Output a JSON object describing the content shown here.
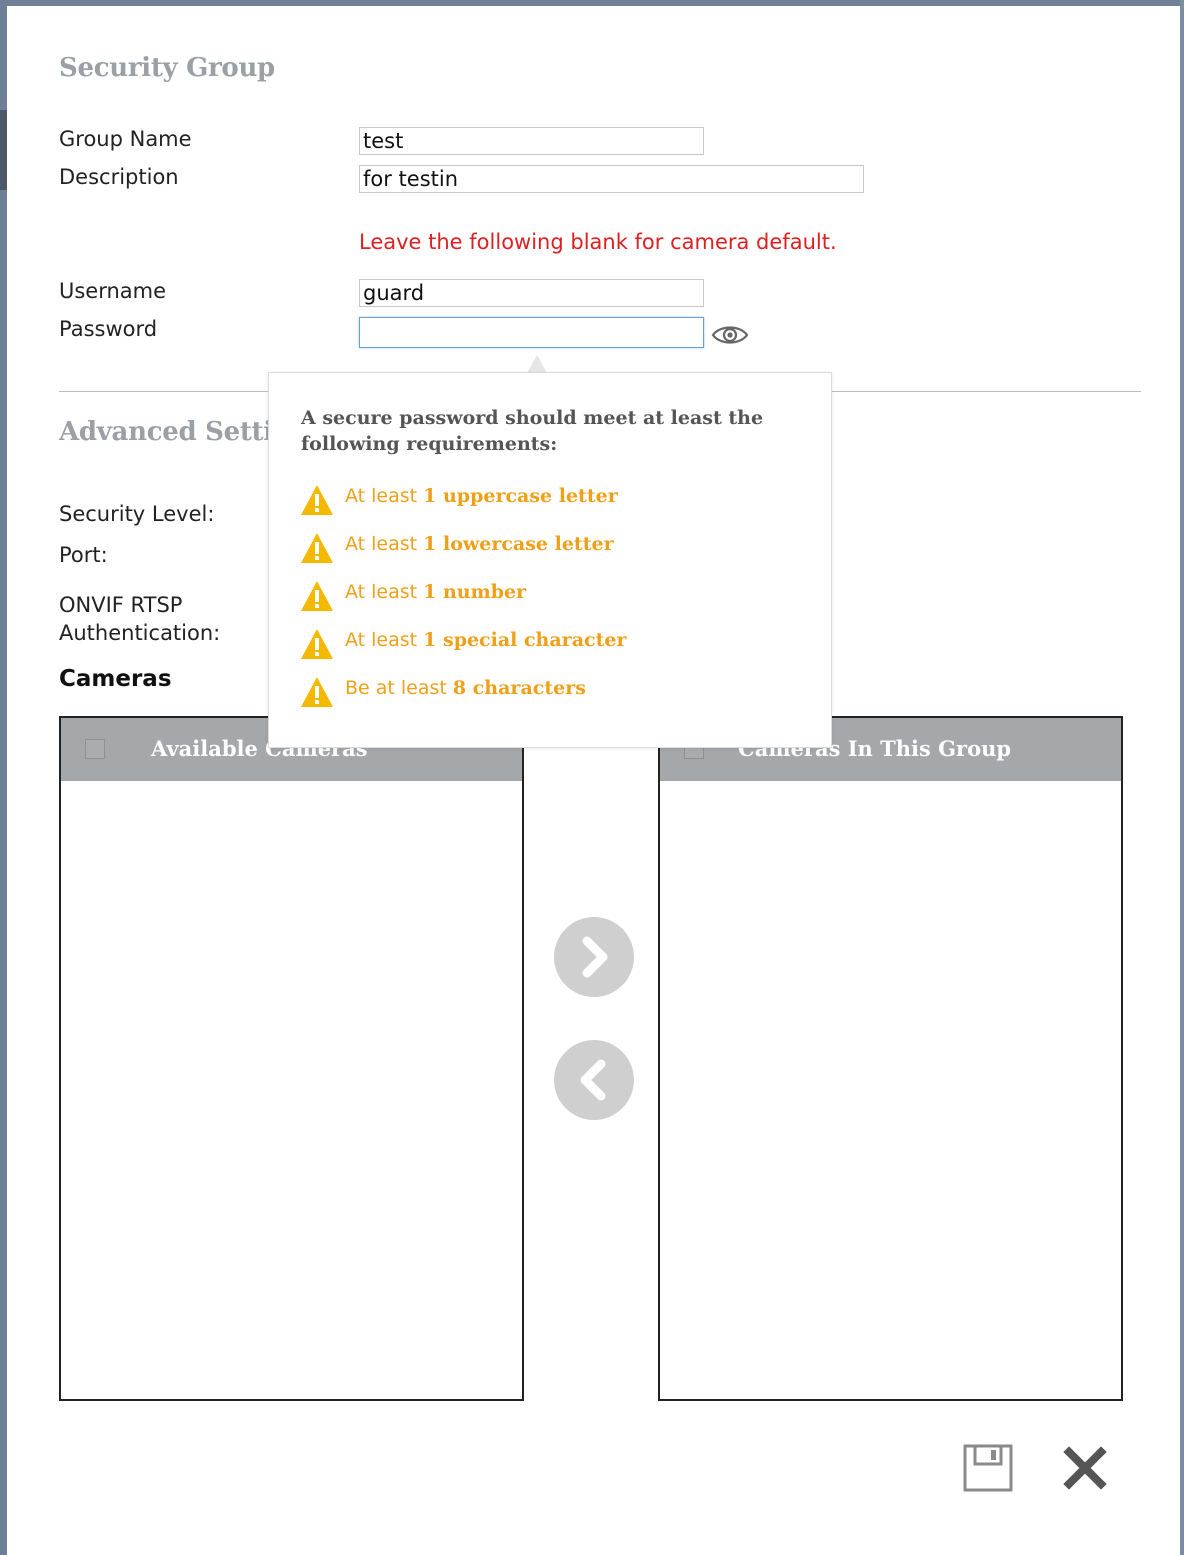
{
  "form": {
    "title": "Security Group",
    "group_name_label": "Group Name",
    "group_name_value": "test",
    "description_label": "Description",
    "description_value": "for testin",
    "note": "Leave the following blank for camera default.",
    "username_label": "Username",
    "username_value": "guard",
    "password_label": "Password",
    "password_value": ""
  },
  "advanced": {
    "title": "Advanced Setti",
    "security_level_label": "Security Level:",
    "port_label": "Port:",
    "onvif_label_line1": "ONVIF RTSP",
    "onvif_label_line2": "Authentication:"
  },
  "cameras": {
    "title": "Cameras",
    "available_header": "Available Cameras",
    "group_header": "Cameras In This Group",
    "available_items": [],
    "group_items": []
  },
  "popover": {
    "title": "A secure password should meet at least the following requirements:",
    "requirements": [
      {
        "prefix": "At least ",
        "bold": "1 uppercase letter"
      },
      {
        "prefix": "At least ",
        "bold": "1 lowercase letter"
      },
      {
        "prefix": "At least ",
        "bold": "1 number"
      },
      {
        "prefix": "At least ",
        "bold": "1 special character"
      },
      {
        "prefix": "Be at least ",
        "bold": "8 characters"
      }
    ]
  },
  "icons": {
    "password_toggle": "eye-icon",
    "move_right": "chevron-right-icon",
    "move_left": "chevron-left-icon",
    "save": "floppy-disk-icon",
    "close": "close-icon",
    "requirement": "warning-icon"
  },
  "colors": {
    "note": "#e02020",
    "warning": "#f0a018",
    "warning_icon": "#f5b800",
    "list_header": "#a4a8ab",
    "section_title": "#9aa0a6"
  }
}
